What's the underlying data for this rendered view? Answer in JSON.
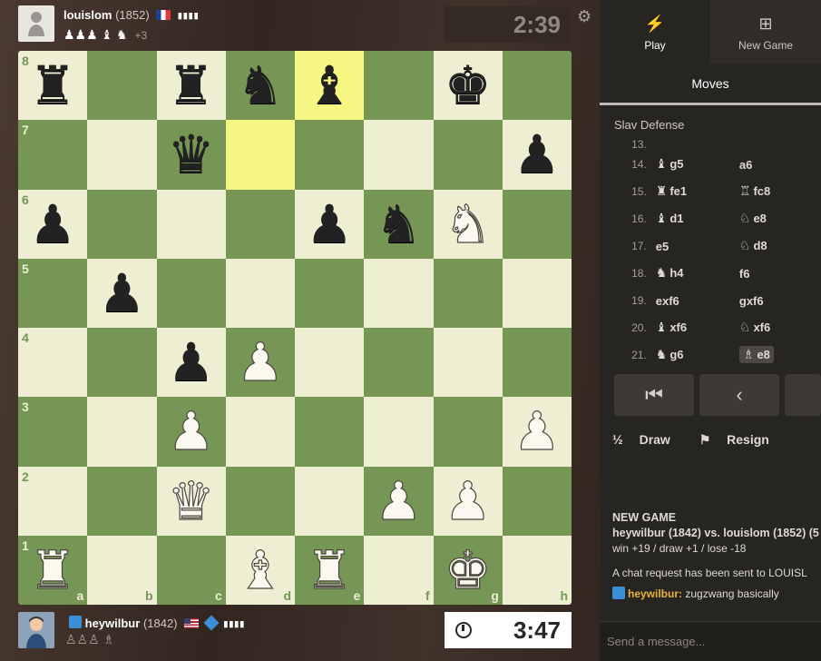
{
  "top_player": {
    "name": "louislom",
    "rating": "(1852)",
    "captured": "♟♟♟ ♝ ♞",
    "advantage": "+3",
    "clock": "2:39"
  },
  "bottom_player": {
    "name": "heywilbur",
    "rating": "(1842)",
    "captured": "♙♙♙ ♗",
    "clock": "3:47"
  },
  "board": {
    "ranks": [
      "8",
      "7",
      "6",
      "5",
      "4",
      "3",
      "2",
      "1"
    ],
    "files": [
      "a",
      "b",
      "c",
      "d",
      "e",
      "f",
      "g",
      "h"
    ],
    "highlighted": [
      "e8",
      "d7"
    ],
    "pieces": {
      "a8": "b:♜",
      "c8": "b:♜",
      "d8": "b:♞",
      "e8": "b:♝",
      "g8": "b:♚",
      "c7": "b:♛",
      "h7": "b:♟",
      "a6": "b:♟",
      "e6": "b:♟",
      "f6": "b:♞",
      "g6": "w:♞",
      "b5": "b:♟",
      "c4": "b:♟",
      "d4": "w:♟",
      "c3": "w:♟",
      "h3": "w:♟",
      "c2": "w:♛",
      "f2": "w:♟",
      "g2": "w:♟",
      "a1": "w:♜",
      "d1": "w:♝",
      "e1": "w:♜",
      "g1": "w:♚"
    }
  },
  "panel": {
    "play_label": "Play",
    "new_game_label": "New Game",
    "moves_tab": "Moves",
    "opening": "Slav Defense",
    "moves": [
      {
        "num": "13.",
        "white": "",
        "black": ""
      },
      {
        "num": "14.",
        "white": "g5",
        "white_piece": "♝",
        "black": "a6",
        "black_piece": ""
      },
      {
        "num": "15.",
        "white": "fe1",
        "white_piece": "♜",
        "black": "fc8",
        "black_piece": "♖"
      },
      {
        "num": "16.",
        "white": "d1",
        "white_piece": "♝",
        "black": "e8",
        "black_piece": "♘"
      },
      {
        "num": "17.",
        "white": "e5",
        "white_piece": "",
        "black": "d8",
        "black_piece": "♘"
      },
      {
        "num": "18.",
        "white": "h4",
        "white_piece": "♞",
        "black": "f6",
        "black_piece": ""
      },
      {
        "num": "19.",
        "white": "exf6",
        "white_piece": "",
        "black": "gxf6",
        "black_piece": ""
      },
      {
        "num": "20.",
        "white": "xf6",
        "white_piece": "♝",
        "black": "xf6",
        "black_piece": "♘"
      },
      {
        "num": "21.",
        "white": "g6",
        "white_piece": "♞",
        "black": "e8",
        "black_piece": "♗"
      }
    ],
    "draw_label": "Draw",
    "resign_label": "Resign",
    "chat": {
      "heading": "NEW GAME",
      "match": "heywilbur (1842) vs. louislom (1852) (5",
      "odds": "win +19 / draw +1 / lose -18",
      "system": "A chat request has been sent to LOUISL",
      "user": "heywilbur:",
      "message": "zugzwang basically"
    },
    "input_placeholder": "Send a message..."
  },
  "colors": {
    "light": "#eeeed2",
    "dark": "#769656",
    "highlight": "#f6f682"
  }
}
